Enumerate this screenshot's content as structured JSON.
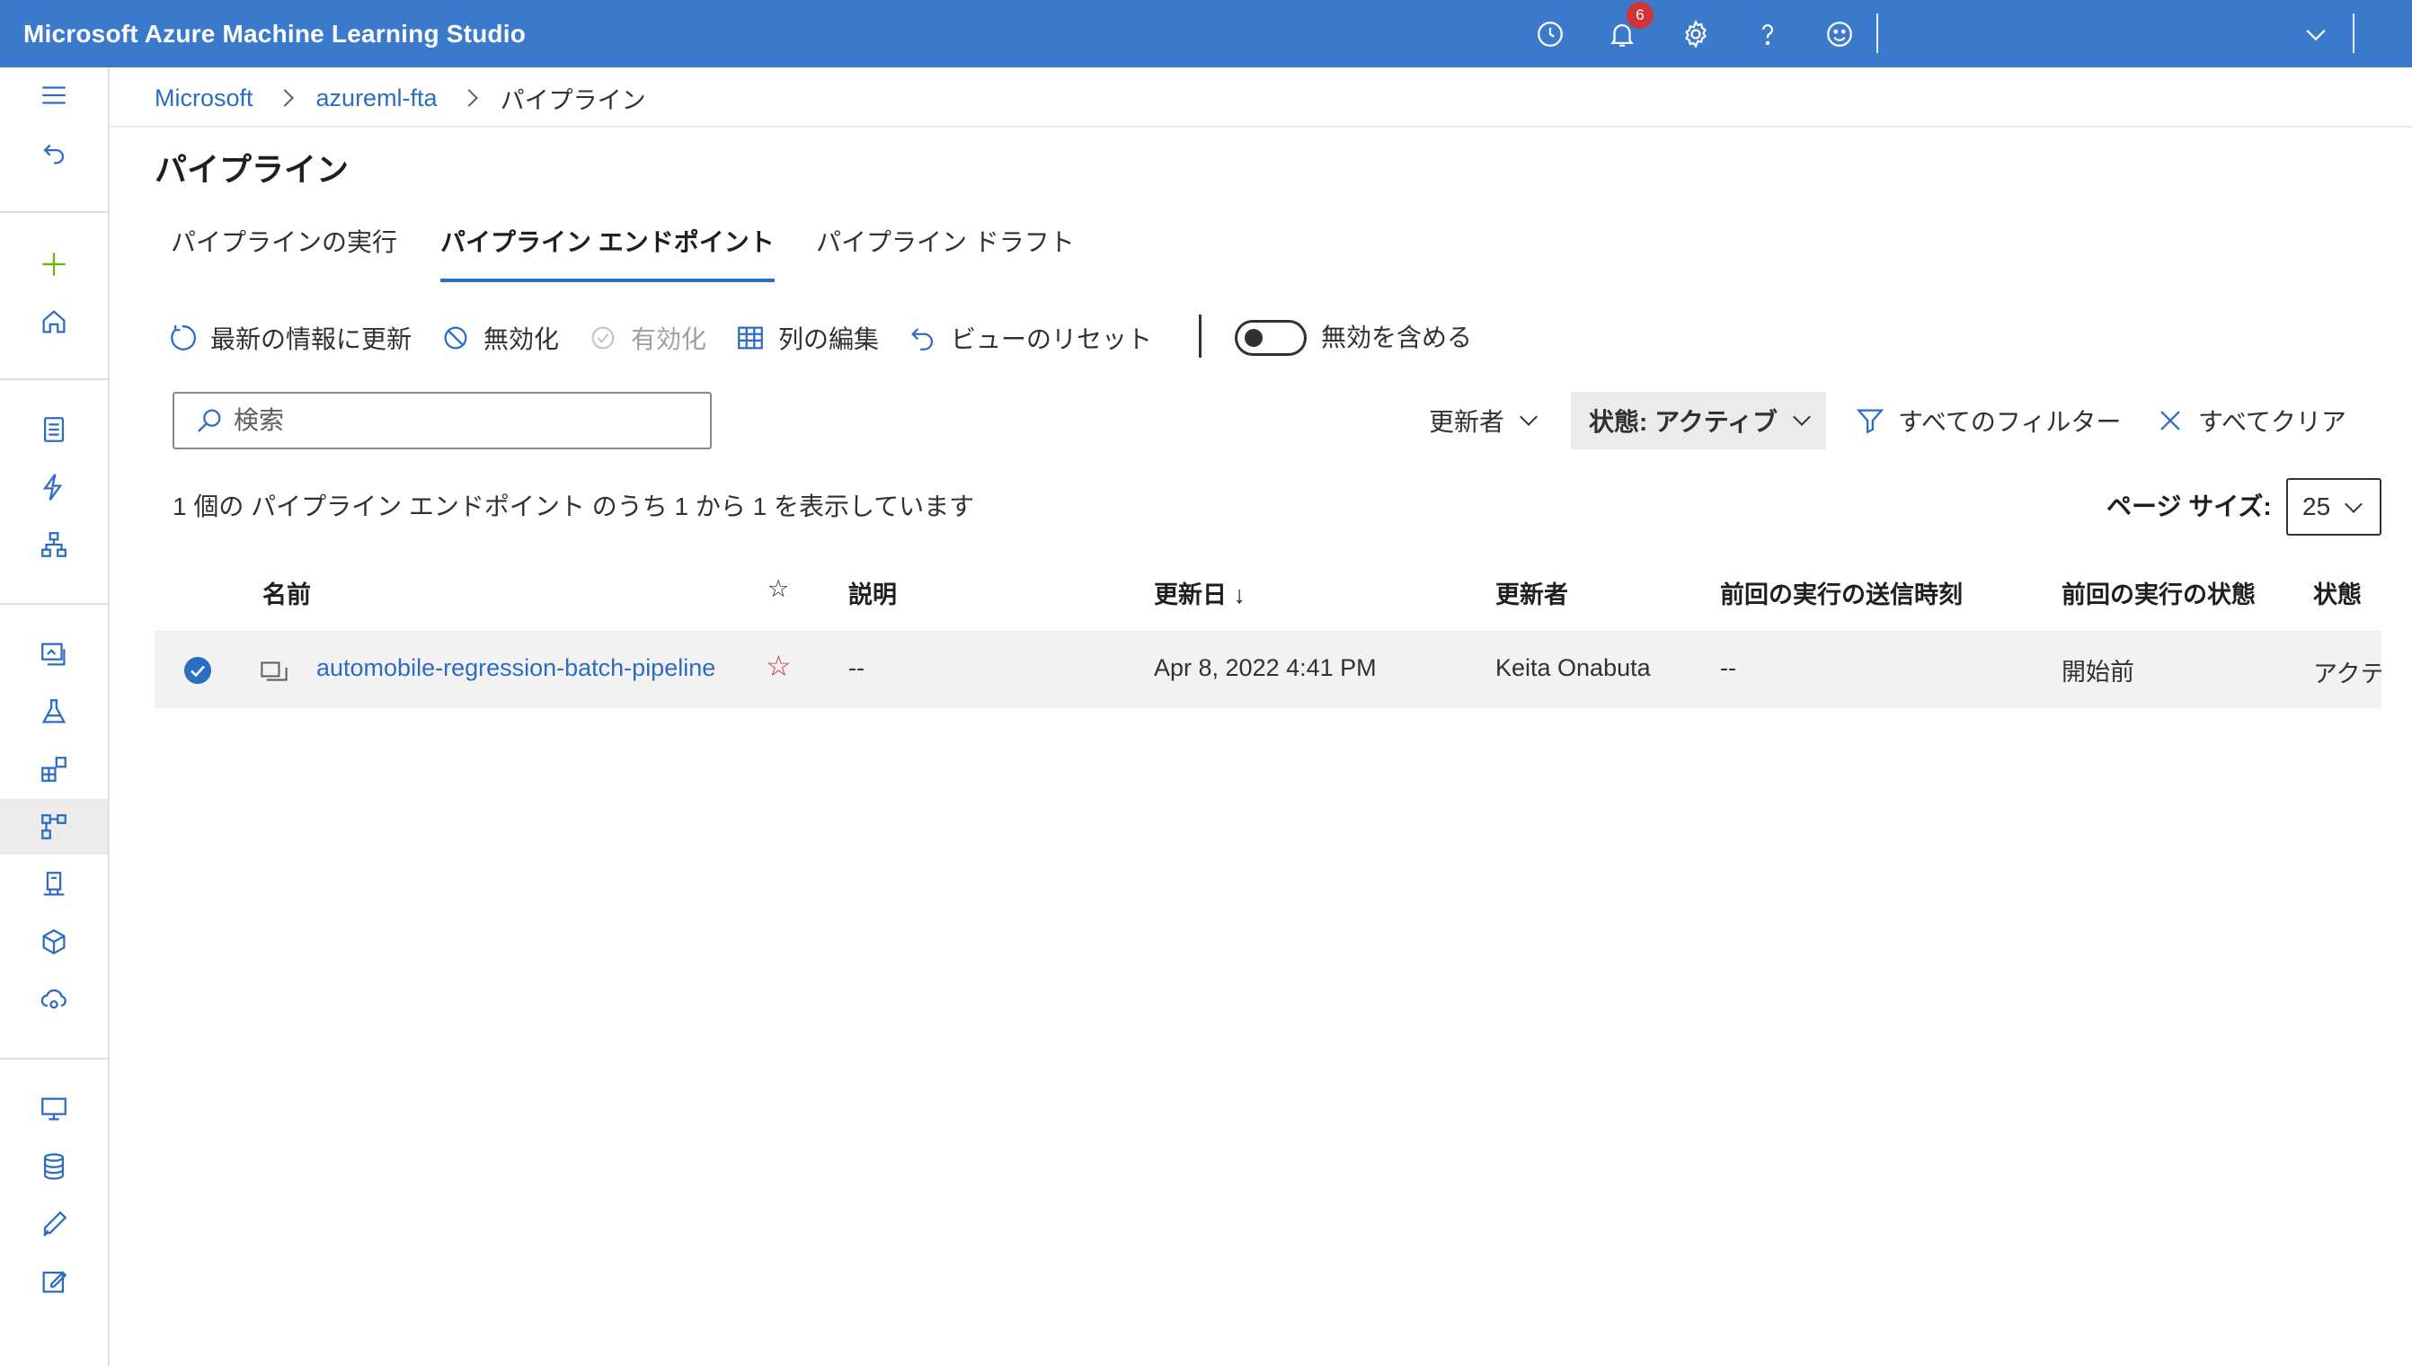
{
  "app": {
    "title": "Microsoft Azure Machine Learning Studio",
    "notification_count": "6"
  },
  "topbar_icons": [
    "history-icon",
    "bell-icon",
    "gear-icon",
    "help-icon",
    "smiley-icon",
    "chevron-down-icon"
  ],
  "breadcrumb": [
    "Microsoft",
    "azureml-fta",
    "パイプライン"
  ],
  "page_title": "パイプライン",
  "tabs": [
    {
      "label": "パイプラインの実行",
      "active": false
    },
    {
      "label": "パイプライン エンドポイント",
      "active": true
    },
    {
      "label": "パイプライン ドラフト",
      "active": false
    }
  ],
  "commands": {
    "refresh": "最新の情報に更新",
    "disable": "無効化",
    "enable": "有効化",
    "edit_columns": "列の編集",
    "reset_view": "ビューのリセット",
    "include_disabled": "無効を含める"
  },
  "search": {
    "placeholder": "検索",
    "value": ""
  },
  "filters": {
    "updated_by": "更新者",
    "status": "状態: アクティブ",
    "all_filters": "すべてのフィルター",
    "clear_all": "すべてクリア"
  },
  "summary": "1 個の パイプライン エンドポイント のうち 1 から 1 を表示しています",
  "page_size": {
    "label": "ページ サイズ:",
    "value": "25"
  },
  "table": {
    "headers": {
      "name": "名前",
      "favorite": "☆",
      "description": "説明",
      "updated_on": "更新日 ↓",
      "updated_by": "更新者",
      "last_run_submitted": "前回の実行の送信時刻",
      "last_run_status": "前回の実行の状態",
      "state": "状態"
    },
    "rows": [
      {
        "name": "automobile-regression-batch-pipeline",
        "favorite": "☆",
        "description": "--",
        "updated_on": "Apr 8, 2022 4:41 PM",
        "updated_by": "Keita Onabuta",
        "last_run_submitted": "--",
        "last_run_status": "開始前",
        "state": "アクティブ",
        "selected": true
      }
    ]
  },
  "colors": {
    "topbar": "#3a79cc",
    "link": "#2b6cc4",
    "badge": "#d13438",
    "favorite": "#c4314b",
    "selected_row": "#f3f2f1"
  }
}
